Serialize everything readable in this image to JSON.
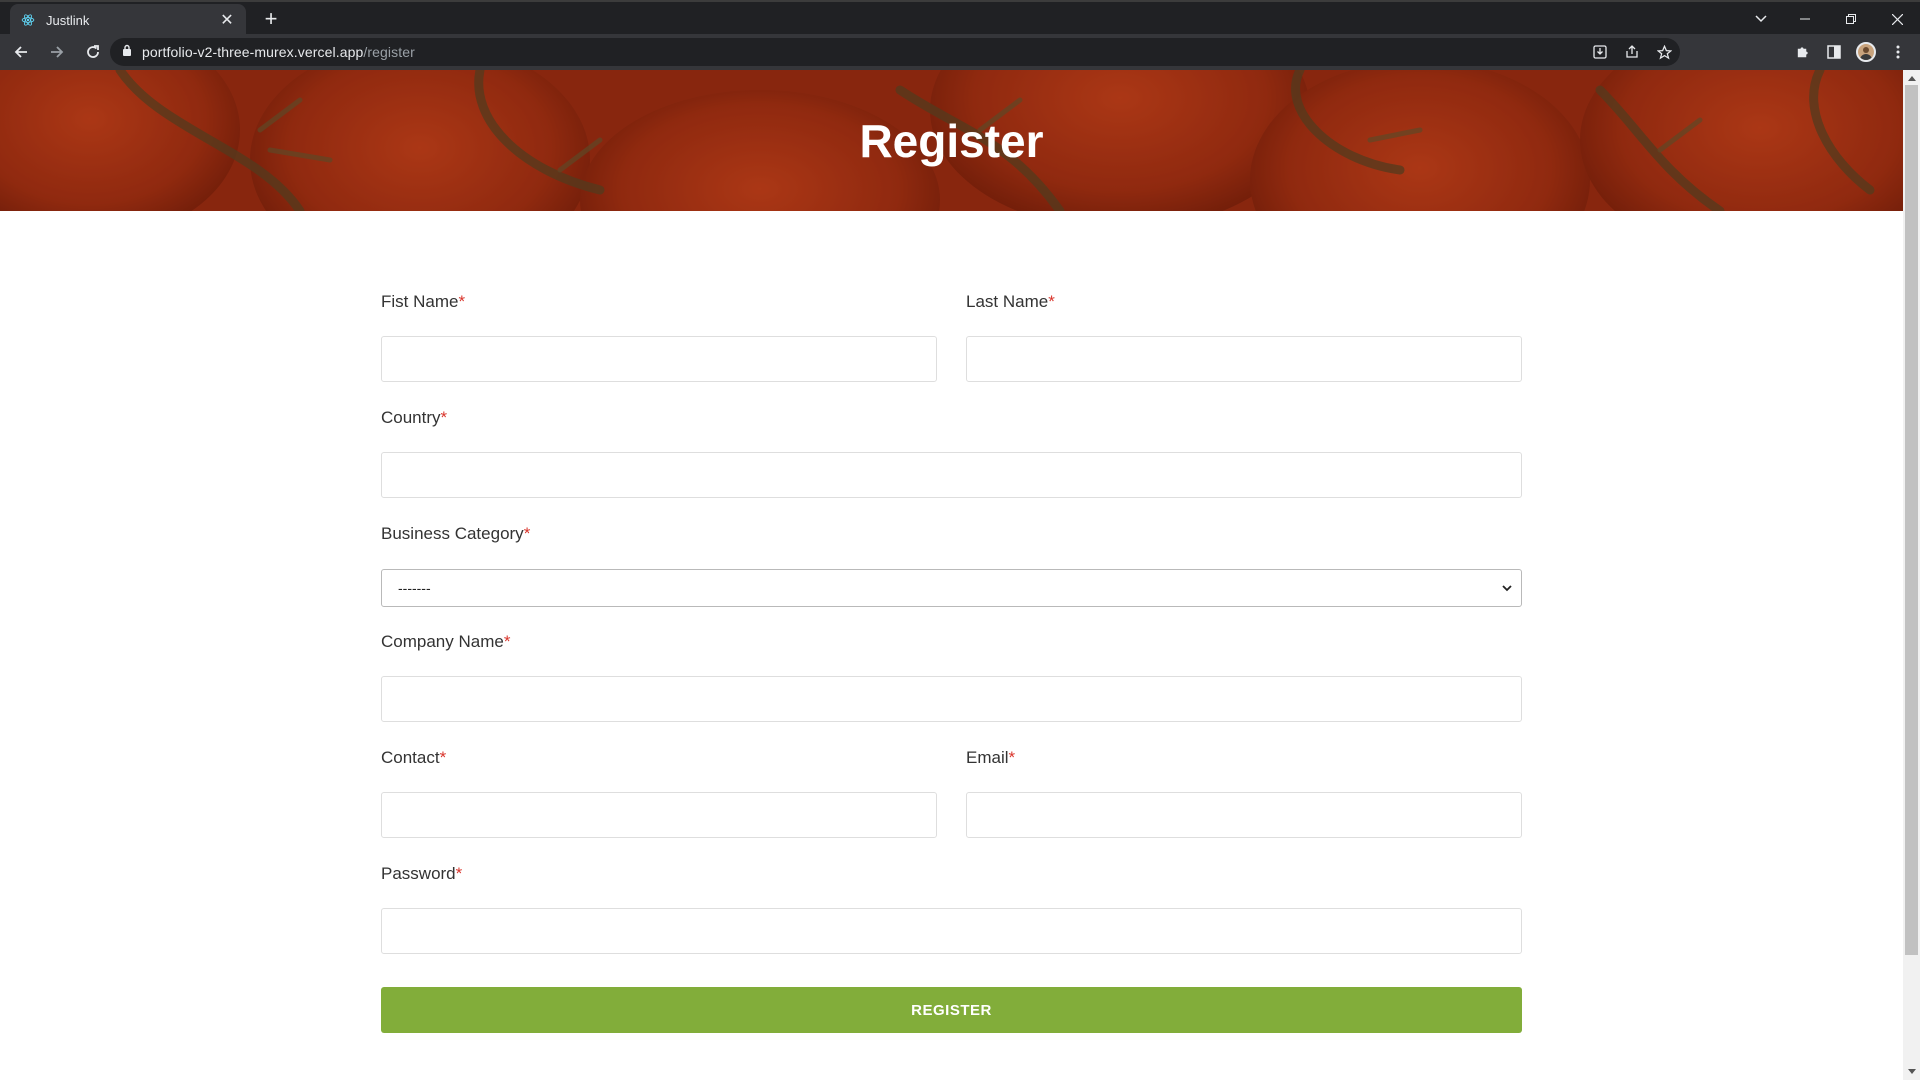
{
  "browser": {
    "tab_title": "Justlink",
    "url_host": "portfolio-v2-three-murex.vercel.app",
    "url_path": "/register",
    "icons": [
      "react-favicon-icon",
      "close-icon",
      "plus-icon",
      "back-icon",
      "forward-icon",
      "reload-icon",
      "lock-icon",
      "install-icon",
      "share-icon",
      "star-icon",
      "extensions-icon",
      "sidepanel-icon",
      "avatar",
      "menu-icon",
      "minimize-icon",
      "restore-icon",
      "window-close-icon",
      "tab-search-icon"
    ]
  },
  "page": {
    "title": "Register",
    "form": {
      "first_name_label": "Fist Name",
      "last_name_label": "Last Name",
      "country_label": "Country",
      "business_category_label": "Business Category",
      "business_category_value": "-------",
      "company_name_label": "Company Name",
      "contact_label": "Contact",
      "email_label": "Email",
      "password_label": "Password",
      "required_mark": "*",
      "submit_label": "REGISTER"
    }
  },
  "colors": {
    "accent_button": "#82ad3a",
    "required": "#d9342b",
    "hero_base": "#8f2a12"
  }
}
